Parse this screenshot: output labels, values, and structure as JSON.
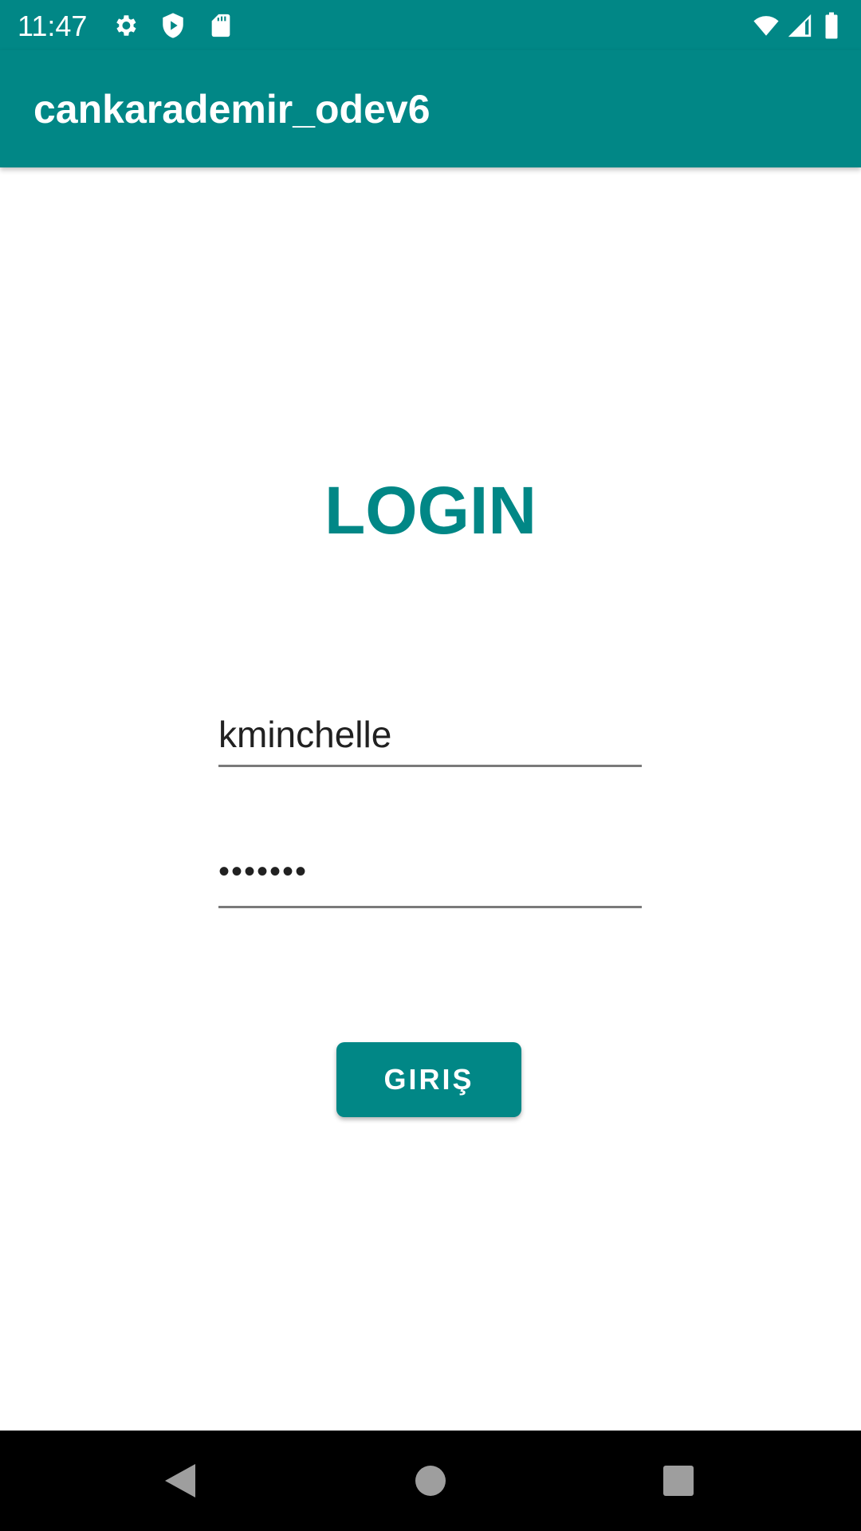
{
  "status_bar": {
    "time": "11:47",
    "icons": [
      "gear-icon",
      "play-protect-icon",
      "sd-card-icon",
      "wifi-icon",
      "signal-icon",
      "battery-icon"
    ]
  },
  "app_bar": {
    "title": "cankarademir_odev6"
  },
  "main": {
    "heading": "LOGIN",
    "username_value": "kminchelle",
    "password_value": "•••••••",
    "login_button": "GIRIŞ"
  },
  "colors": {
    "primary": "#018786"
  },
  "nav_bar": {
    "icons": [
      "back-icon",
      "home-icon",
      "recents-icon"
    ]
  }
}
